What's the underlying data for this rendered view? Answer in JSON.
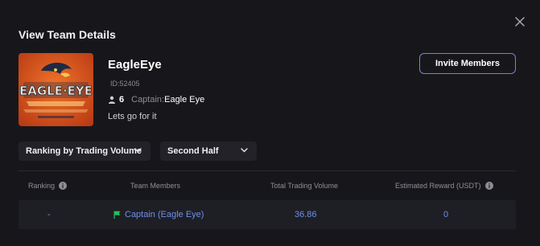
{
  "modal": {
    "title": "View Team Details"
  },
  "team": {
    "logo_text": "EAGLE·EYE",
    "name": "EagleEye",
    "id": "ID:52405",
    "member_count": "6",
    "captain_label": "Captain:",
    "captain_name": "Eagle Eye",
    "slogan": "Lets go for it"
  },
  "actions": {
    "invite_label": "Invite Members"
  },
  "filters": {
    "ranking_select": "Ranking by Trading Volume",
    "period_select": "Second Half"
  },
  "table": {
    "headers": {
      "ranking": "Ranking",
      "members": "Team Members",
      "volume": "Total Trading Volume",
      "reward": "Estimated Reward (USDT)"
    },
    "rows": [
      {
        "ranking": "-",
        "members": "Captain (Eagle Eye)",
        "volume": "36.86",
        "reward": "0"
      }
    ]
  },
  "colors": {
    "accent": "#6f8ee8",
    "invite_border": "#6f86d6",
    "flag": "#22c55e"
  }
}
